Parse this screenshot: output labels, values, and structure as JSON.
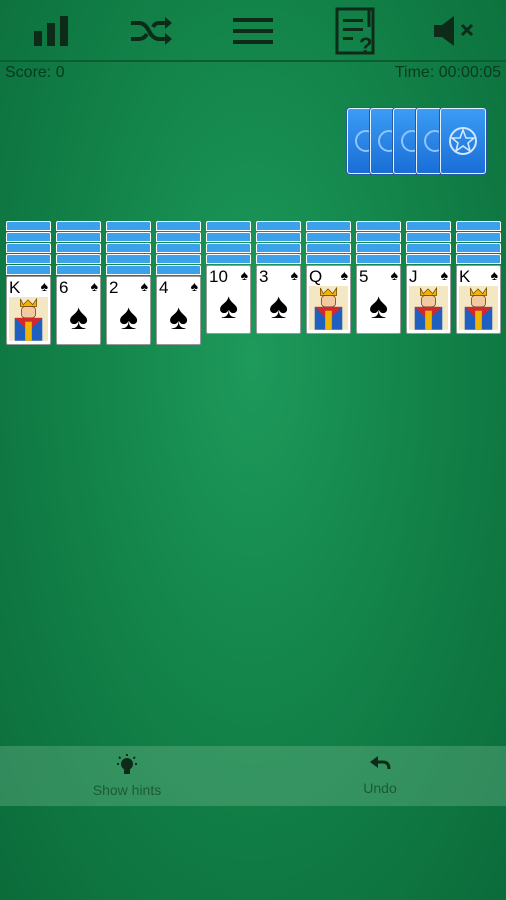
{
  "toolbar": {
    "icons": [
      "stats-icon",
      "shuffle-icon",
      "menu-icon",
      "rules-icon",
      "mute-icon"
    ]
  },
  "status": {
    "score": "Score: 0",
    "time": "Time: 00:00:05"
  },
  "stock": {
    "remaining_deals": 5
  },
  "tableau": [
    {
      "hidden": 5,
      "rank": "K",
      "suit": "♠",
      "court": true
    },
    {
      "hidden": 5,
      "rank": "6",
      "suit": "♠",
      "court": false
    },
    {
      "hidden": 5,
      "rank": "2",
      "suit": "♠",
      "court": false
    },
    {
      "hidden": 5,
      "rank": "4",
      "suit": "♠",
      "court": false
    },
    {
      "hidden": 4,
      "rank": "10",
      "suit": "♠",
      "court": false
    },
    {
      "hidden": 4,
      "rank": "3",
      "suit": "♠",
      "court": false
    },
    {
      "hidden": 4,
      "rank": "Q",
      "suit": "♠",
      "court": true
    },
    {
      "hidden": 4,
      "rank": "5",
      "suit": "♠",
      "court": false
    },
    {
      "hidden": 4,
      "rank": "J",
      "suit": "♠",
      "court": true
    },
    {
      "hidden": 4,
      "rank": "K",
      "suit": "♠",
      "court": true
    }
  ],
  "bottom": {
    "hints_label": "Show hints",
    "undo_label": "Undo"
  },
  "colors": {
    "felt": "#13844a",
    "card_back": "#3aa1ea",
    "stock_back": "#1a6ed6"
  }
}
